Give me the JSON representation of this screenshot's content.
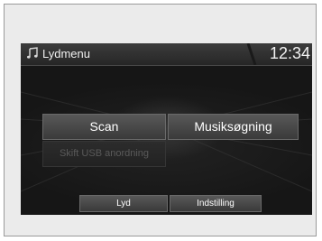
{
  "header": {
    "title": "Lydmenu",
    "clock": "12:34",
    "icon": "music-note-icon"
  },
  "menu": {
    "scan_label": "Scan",
    "music_search_label": "Musiksøgning",
    "usb_label": "Skift USB anordning"
  },
  "bottom_bar": {
    "sound_label": "Lyd",
    "settings_label": "Indstilling"
  },
  "colors": {
    "screen_bg": "#161616",
    "button_bg": "#4a4a4a",
    "disabled_text": "#5a5a5a"
  }
}
